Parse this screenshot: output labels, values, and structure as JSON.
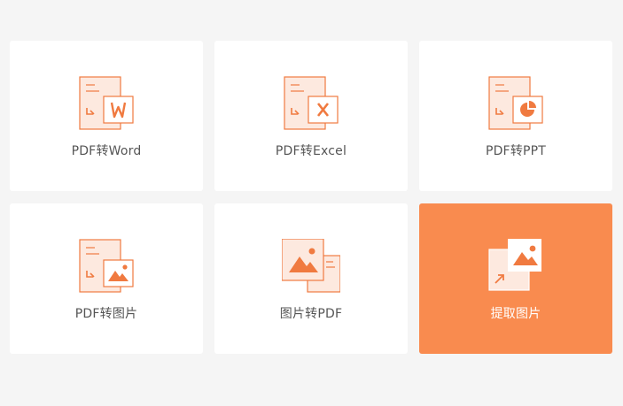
{
  "tools": [
    {
      "label": "PDF转Word"
    },
    {
      "label": "PDF转Excel"
    },
    {
      "label": "PDF转PPT"
    },
    {
      "label": "PDF转图片"
    },
    {
      "label": "图片转PDF"
    },
    {
      "label": "提取图片"
    }
  ],
  "colors": {
    "accent": "#f98b4f",
    "icon_stroke": "#f07a40",
    "icon_fill": "#fde9df",
    "background": "#f5f5f5",
    "card": "#ffffff",
    "text": "#555555"
  }
}
